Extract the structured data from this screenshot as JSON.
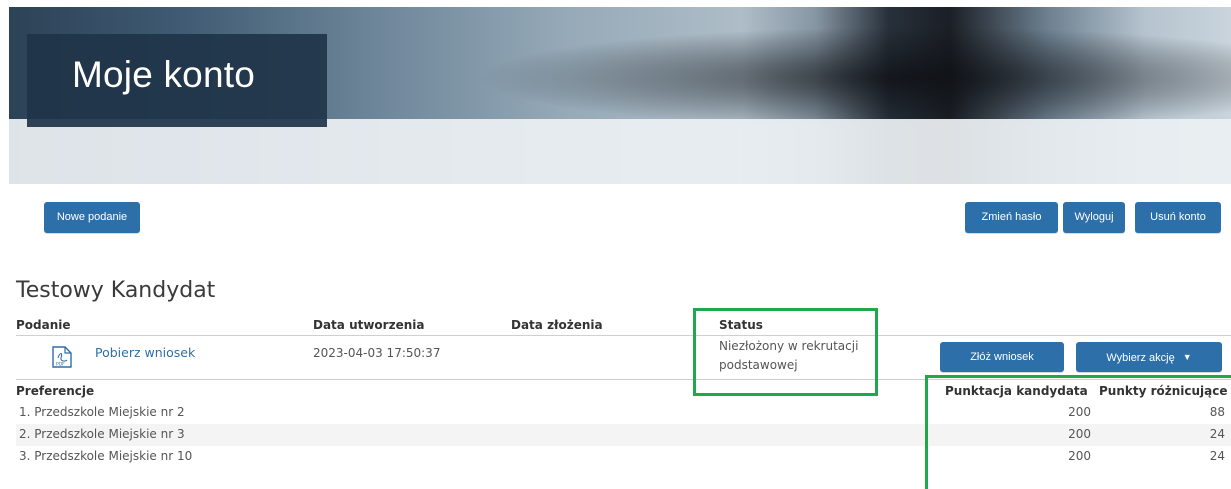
{
  "header": {
    "title": "Moje konto"
  },
  "toolbar": {
    "new_submission_label": "Nowe podanie",
    "change_password_label": "Zmień hasło",
    "logout_label": "Wyloguj",
    "delete_account_label": "Usuń konto"
  },
  "candidate": {
    "name": "Testowy Kandydat"
  },
  "application_table": {
    "headers": {
      "submission": "Podanie",
      "created": "Data utworzenia",
      "submitted": "Data złożenia",
      "status": "Status"
    },
    "row": {
      "link_label": "Pobierz wniosek",
      "pdf_icon_label": "PDF",
      "created": "2023-04-03 17:50:37",
      "submitted": "",
      "status_line1": "Niezłożony w rekrutacji",
      "status_line2": "podstawowej",
      "submit_button_label": "Złóż wniosek",
      "action_button_label": "Wybierz akcję"
    }
  },
  "preferences": {
    "header_label": "Preferencje",
    "score_header": "Punktacja kandydata",
    "diff_header": "Punkty różnicujące",
    "items": [
      {
        "name": "1. Przedszkole Miejskie nr 2",
        "score": "200",
        "diff": "88"
      },
      {
        "name": "2. Przedszkole Miejskie nr 3",
        "score": "200",
        "diff": "24"
      },
      {
        "name": "3. Przedszkole Miejskie nr 10",
        "score": "200",
        "diff": "24"
      }
    ]
  },
  "colors": {
    "button_blue": "#2d6fa8",
    "highlight_green": "#1ea84b",
    "title_box": "#203448"
  }
}
